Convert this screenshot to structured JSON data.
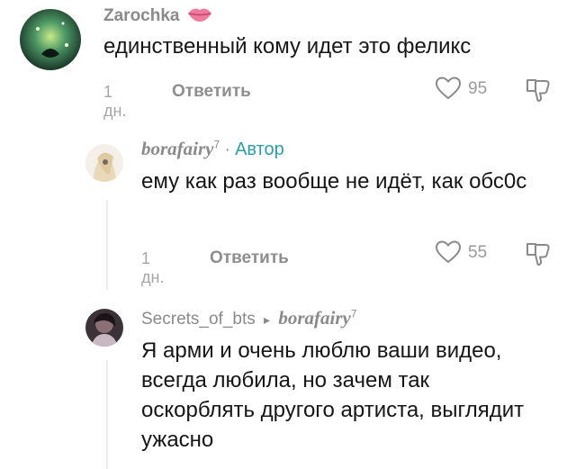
{
  "comments": [
    {
      "username": "Zarochka",
      "text": "единственный кому идет это феликс",
      "time": "1 дн.",
      "reply_label": "Ответить",
      "likes": "95"
    },
    {
      "username": "borafairy",
      "superscript": "7",
      "separator": " · ",
      "author_label": "Автор",
      "text": "ему как раз вообще не идёт, как обс0с",
      "time": "1 дн.",
      "reply_label": "Ответить",
      "likes": "55"
    },
    {
      "username": "Secrets_of_bts",
      "reply_arrow": "▸",
      "reply_to": "borafairy",
      "reply_to_superscript": "7",
      "text": "Я арми и очень люблю ваши видео, всегда любила, но зачем так оскорблять другого артиста, выглядит ужасно"
    }
  ],
  "icons": {
    "lips_icon": "lips-icon",
    "heart_icon": "heart-icon",
    "dislike_icon": "thumbs-down-icon"
  }
}
